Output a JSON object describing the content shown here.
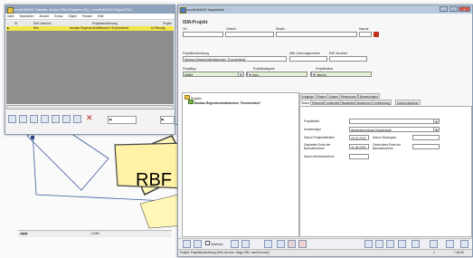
{
  "table_window": {
    "title": "novaKANDIS Tabellen-Editor [ISM-Projekte (6)] - novaKANDIS ObjectTOC",
    "menu": [
      "Datei",
      "Bearbeiten",
      "Ansicht",
      "Extras",
      "Objekt",
      "Fenster",
      "Hilfe"
    ],
    "columns": [
      "ID",
      "EAP-Nummer",
      "Projektbezeichnung",
      "Projekt"
    ],
    "row": {
      "id": "",
      "eap": "Neu",
      "name": "Neubau Regenrückhaltebecken \"Erscherbleck\"",
      "status": "In Planung"
    }
  },
  "map": {
    "label": "RBF"
  },
  "form_window": {
    "title": "novaKANDIS Inspektion",
    "heading": "ISM-Projekt",
    "labels": {
      "ort": "Ort",
      "ortsteil": "Ortsteil",
      "strasse": "Straße",
      "hausnr": "Hausnr",
      "projektbezeichnung": "Projektbezeichnung",
      "abk": "ABK-Ordnungsnummer",
      "eap": "EAP-Nummer",
      "projekttyp": "Projekttyp",
      "projektkategorie": "Projektkategorie",
      "projektstatus": "Projektstatus"
    },
    "values": {
      "projektbezeichnung": "Neubau Regenrückhaltebecken \"Erscherbleck\"",
      "projekttyp": "Alfalfa",
      "projektkategorie": "Neubau",
      "projektstatus": "In Planung"
    },
    "tree": {
      "root": "Projekte",
      "item": "Neubau Regenrückhaltebecken \"Erscherbleck\""
    },
    "tabs": [
      "Vorgänge",
      "Phasen",
      "Kosten",
      "Ressourcen",
      "Bemerkungen",
      "Status",
      "Elemente",
      "Vorbereiter",
      "Baustellen",
      "Bauformen",
      "Vorbereitung",
      "Ansprechpartner"
    ],
    "details": {
      "projektleiter": "Projektleiter",
      "kostentraeger": "Kostenträger",
      "kostentraeger_value": "Abwasserverband Musterstadt",
      "datum_definition": "Datum Projektdefinition",
      "datum_definition_value": "20.02.2015",
      "datum_baubeginn": "Datum Baubeginn",
      "geplantes_ende": "Geplantes Ende der Baumaßnahme",
      "geplantes_ende_value": "31.08.2015",
      "geplantes_ende2": "Gedrucktes Ende der Baumaßnahme",
      "datum_inbetrieb": "Datum Inbetriebnahme"
    },
    "toolbar": {
      "zeichnen": "Zeichnen"
    },
    "status_left": "Projekt: Projektbezeichnung [Text mit max. Länge 255 / maxText sein]",
    "status_right": "1",
    "status_time": "7:18:09"
  },
  "taskbar_small": {
    "zoom": "1:1000"
  }
}
